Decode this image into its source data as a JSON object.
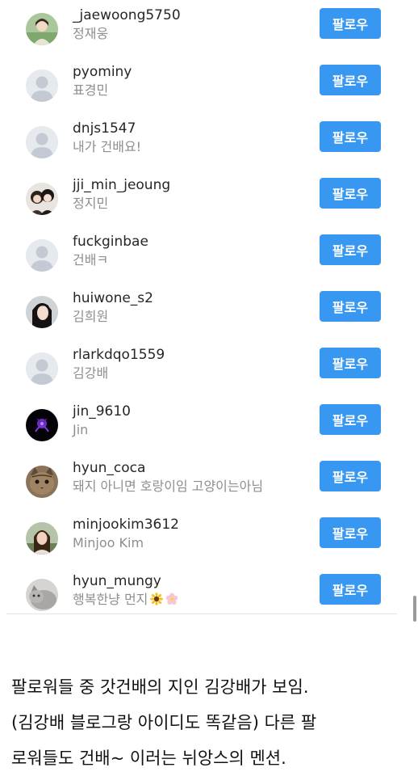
{
  "followers": [
    {
      "username": "_jaewoong5750",
      "subname": "정재웅",
      "avatar": "photo-person-green",
      "button": "팔로우"
    },
    {
      "username": "pyominy",
      "subname": "표경민",
      "avatar": "default-avatar",
      "button": "팔로우"
    },
    {
      "username": "dnjs1547",
      "subname": "내가 건배요!",
      "avatar": "default-avatar",
      "button": "팔로우"
    },
    {
      "username": "jji_min_jeoung",
      "subname": "정지민",
      "avatar": "photo-two-people",
      "button": "팔로우"
    },
    {
      "username": "fuckginbae",
      "subname": "건배ㅋ",
      "avatar": "default-avatar",
      "button": "팔로우"
    },
    {
      "username": "huiwone_s2",
      "subname": "김희원",
      "avatar": "photo-person-dark-hair",
      "button": "팔로우"
    },
    {
      "username": "rlarkdqo1559",
      "subname": "김강배",
      "avatar": "default-avatar",
      "button": "팔로우"
    },
    {
      "username": "jin_9610",
      "subname": "Jin",
      "avatar": "photo-purple-dark",
      "button": "팔로우"
    },
    {
      "username": "hyun_coca",
      "subname": "돼지 아니면 호랑이임 고양이는아님",
      "avatar": "photo-cat",
      "button": "팔로우"
    },
    {
      "username": "minjookim3612",
      "subname": "Minjoo Kim",
      "avatar": "photo-person-outdoor",
      "button": "팔로우"
    },
    {
      "username": "hyun_mungy",
      "subname": "행복한냥 먼지",
      "avatar": "photo-cat-gray",
      "button": "팔로우",
      "emojis": [
        "sunflower-icon",
        "blossom-icon"
      ]
    }
  ],
  "caption": {
    "line1": "팔로워들 중 갓건배의 지인 김강배가 보임.",
    "line2": "(김강배 블로그랑 아이디도 똑같음) 다른 팔",
    "line3": "로워들도 건배~ 이러는 뉘앙스의 멘션."
  },
  "colors": {
    "follow_button": "#3897f0",
    "username_text": "#262626",
    "subname_text": "#8e8e8e",
    "default_avatar_bg": "#e6e9ee",
    "default_avatar_fg": "#c4cad3"
  }
}
